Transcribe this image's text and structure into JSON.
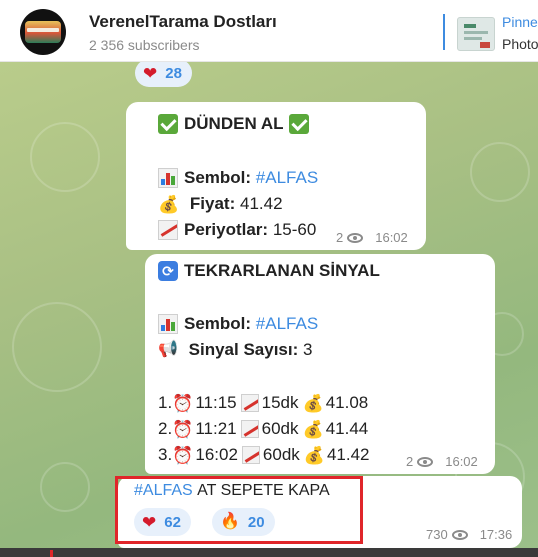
{
  "channel": {
    "title": "VerenelTarama Dostları",
    "subscribers": "2 356 subscribers"
  },
  "pinned": {
    "title": "Pinne",
    "subtitle": "Photo"
  },
  "reactions_top": {
    "heart_count": "28"
  },
  "message1": {
    "title": "DÜNDEN AL",
    "symbol_label": "Sembol:",
    "symbol_value": "#ALFAS",
    "price_label": "Fiyat:",
    "price_value": "41.42",
    "periods_label": "Periyotlar:",
    "periods_value": "15-60",
    "views": "2",
    "time": "16:02"
  },
  "message2": {
    "title": "TEKRARLANAN SİNYAL",
    "symbol_label": "Sembol:",
    "symbol_value": "#ALFAS",
    "count_label": "Sinyal Sayısı:",
    "count_value": "3",
    "signals": [
      {
        "index": "1.",
        "time": "11:15",
        "period": "15dk",
        "price": "41.08"
      },
      {
        "index": "2.",
        "time": "11:21",
        "period": "60dk",
        "price": "41.44"
      },
      {
        "index": "3.",
        "time": "16:02",
        "period": "60dk",
        "price": "41.42"
      }
    ],
    "views": "2",
    "time": "16:02"
  },
  "message3": {
    "tag": "#ALFAS",
    "text": "AT SEPETE KAPA",
    "heart_count": "62",
    "fire_count": "20",
    "views": "730",
    "time": "17:36"
  },
  "colors": {
    "accent": "#3d8be0",
    "highlight": "#e0262a",
    "heart": "#d41b2c"
  }
}
